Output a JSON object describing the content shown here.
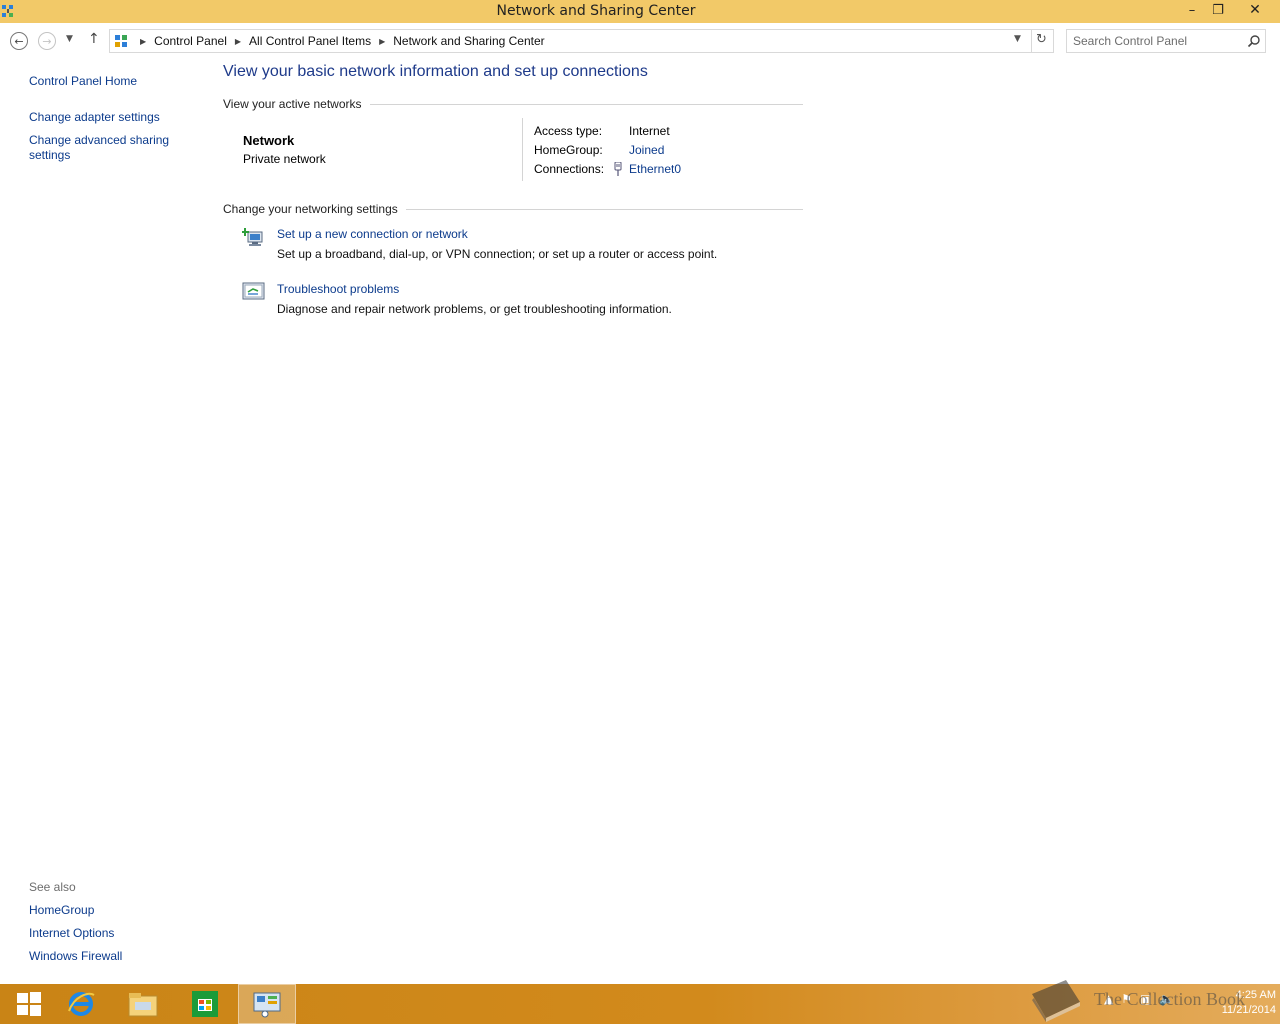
{
  "window": {
    "title": "Network and Sharing Center",
    "minimize": "–",
    "maximize": "❐",
    "close": "✕"
  },
  "address": {
    "breadcrumbs": [
      "Control Panel",
      "All Control Panel Items",
      "Network and Sharing Center"
    ],
    "search_placeholder": "Search Control Panel"
  },
  "left_pane": {
    "home": "Control Panel Home",
    "adapter": "Change adapter settings",
    "advanced": "Change advanced sharing settings",
    "see_also": "See also",
    "links": [
      "HomeGroup",
      "Internet Options",
      "Windows Firewall"
    ]
  },
  "main": {
    "title": "View your basic network information and set up connections",
    "active_networks_heading": "View your active networks",
    "network_name": "Network",
    "network_type": "Private network",
    "props": {
      "access_type_label": "Access type:",
      "access_type_value": "Internet",
      "homegroup_label": "HomeGroup:",
      "homegroup_value": "Joined",
      "connections_label": "Connections:",
      "connections_value": "Ethernet0"
    },
    "change_heading": "Change your networking settings",
    "tasks": [
      {
        "title": "Set up a new connection or network",
        "desc": "Set up a broadband, dial-up, or VPN connection; or set up a router or access point."
      },
      {
        "title": "Troubleshoot problems",
        "desc": "Diagnose and repair network problems, or get troubleshooting information."
      }
    ]
  },
  "taskbar": {
    "time": "4:25 AM",
    "date": "11/21/2014",
    "watermark": "The Collection Book"
  }
}
